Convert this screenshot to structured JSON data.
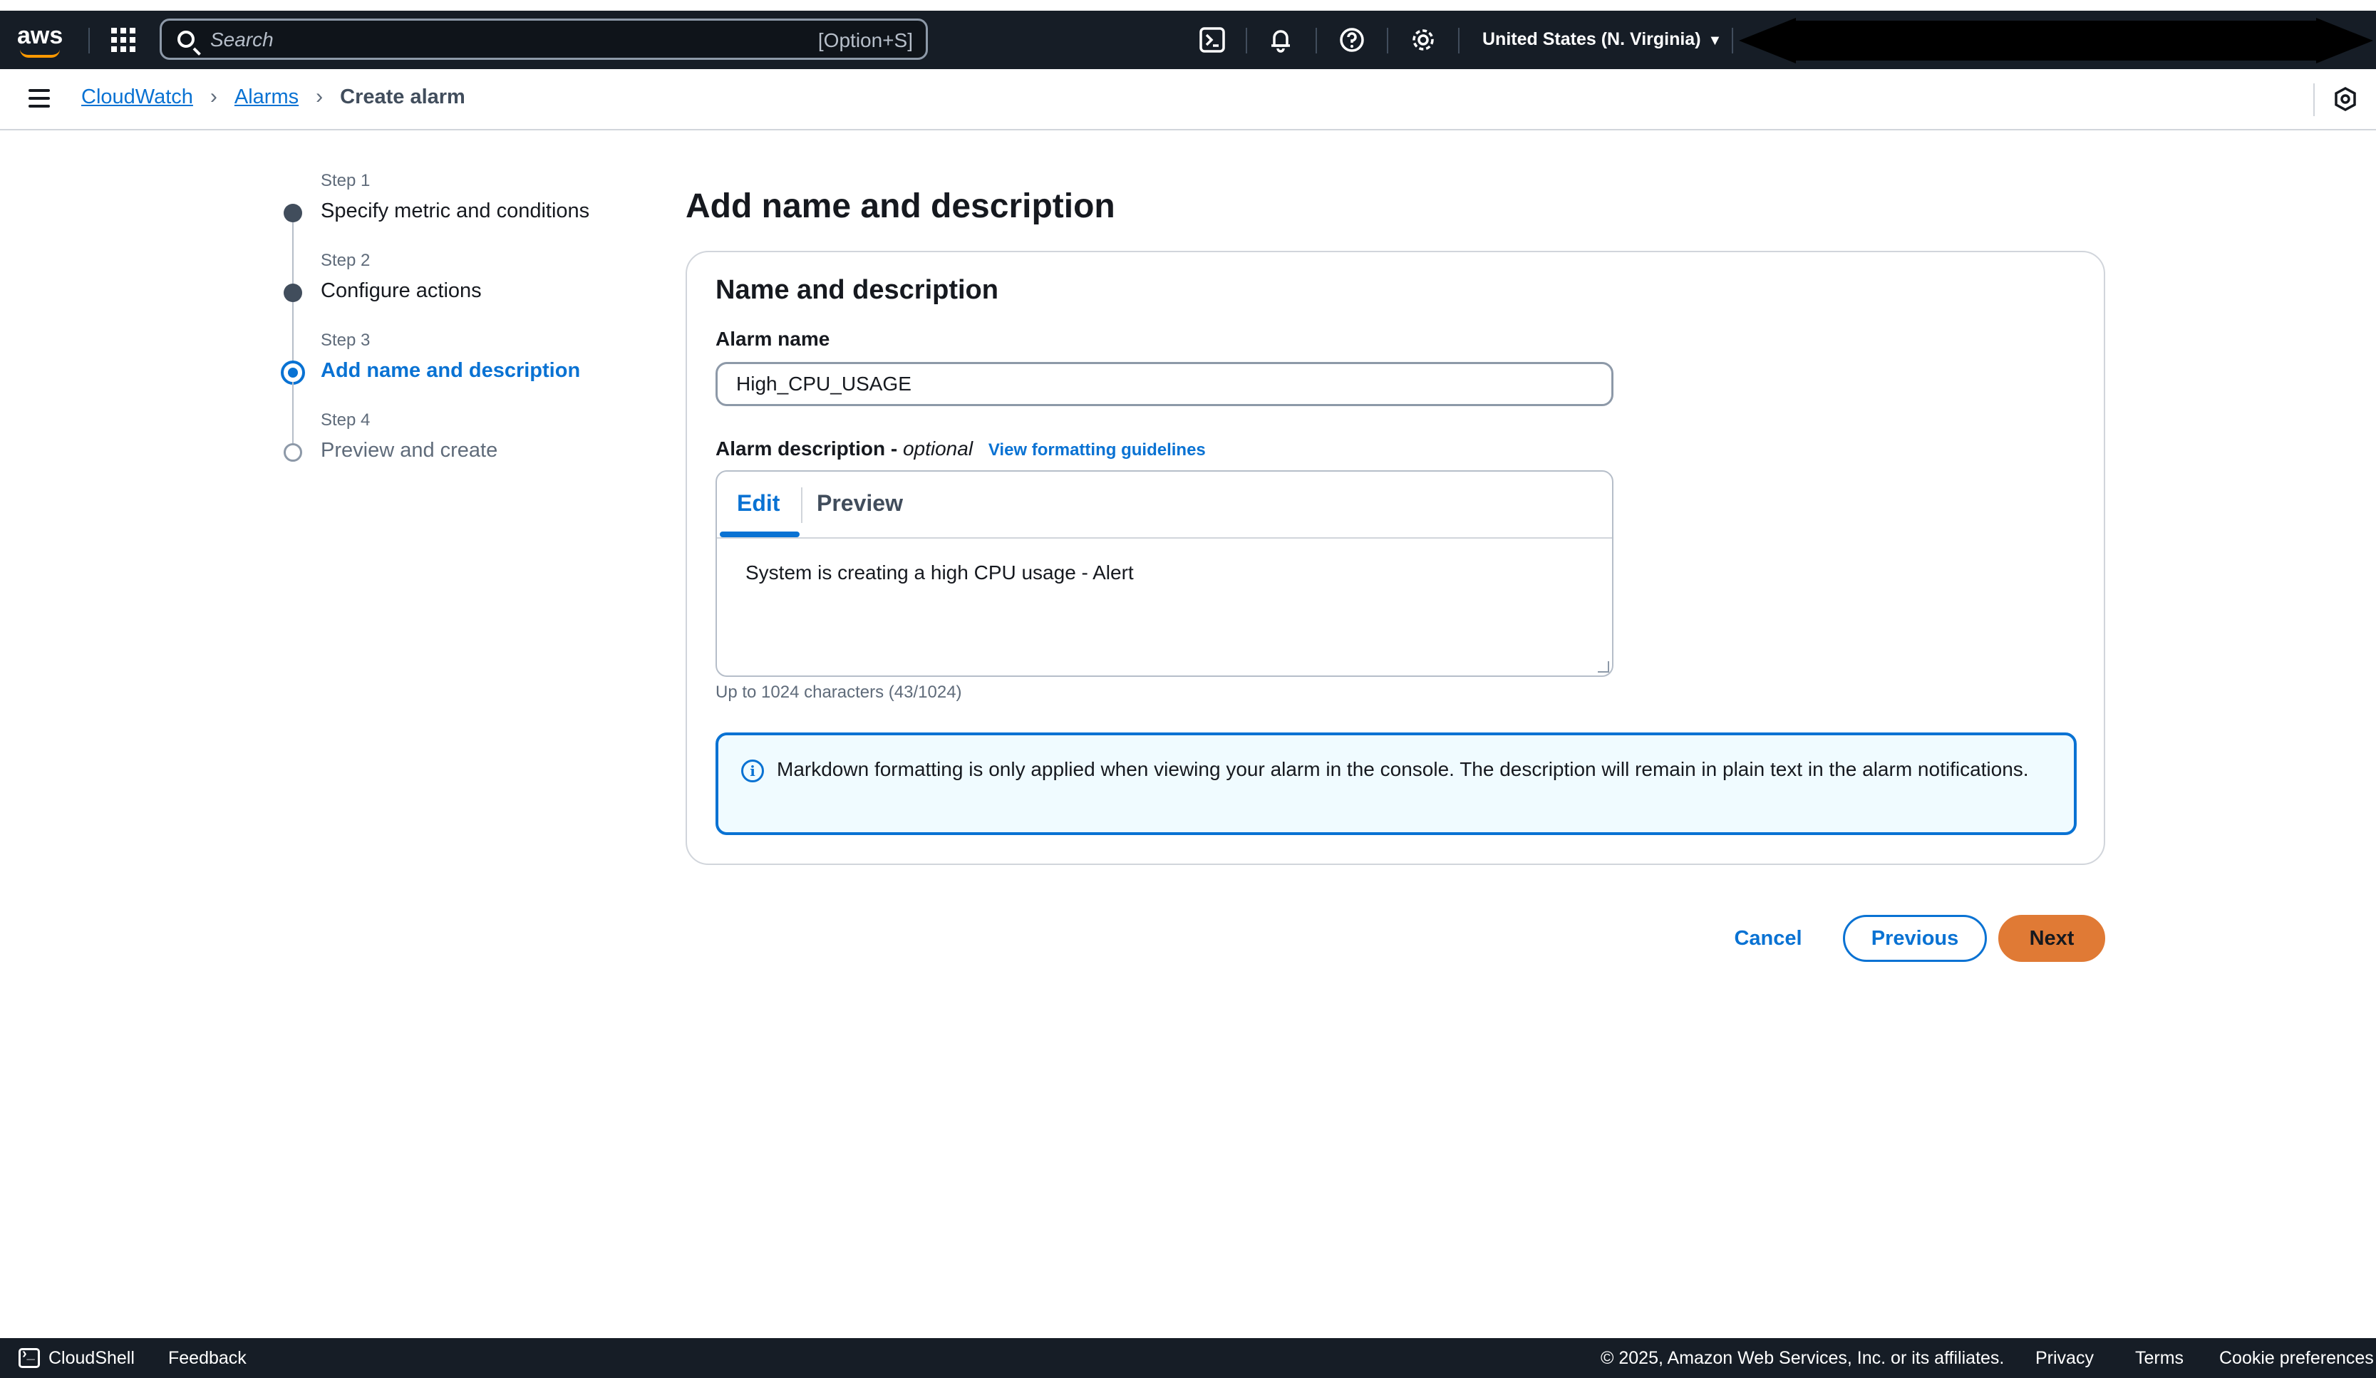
{
  "topbar": {
    "logo_text": "aws",
    "search_placeholder": "Search",
    "search_shortcut": "[Option+S]",
    "region": "United States (N. Virginia)",
    "region_caret": "▼"
  },
  "breadcrumb": {
    "items": [
      "CloudWatch",
      "Alarms"
    ],
    "current": "Create alarm",
    "separator": "›"
  },
  "steps": [
    {
      "num": "Step 1",
      "label": "Specify metric and conditions",
      "state": "completed"
    },
    {
      "num": "Step 2",
      "label": "Configure actions",
      "state": "completed"
    },
    {
      "num": "Step 3",
      "label": "Add name and description",
      "state": "active"
    },
    {
      "num": "Step 4",
      "label": "Preview and create",
      "state": "pending"
    }
  ],
  "main": {
    "page_title": "Add name and description",
    "container_title": "Name and description",
    "alarm_name_label": "Alarm name",
    "alarm_name_value": "High_CPU_USAGE",
    "alarm_desc_label": "Alarm description -",
    "alarm_desc_optional": "optional",
    "formatting_link": "View formatting guidelines",
    "tabs": [
      {
        "label": "Edit",
        "active": true
      },
      {
        "label": "Preview",
        "active": false
      }
    ],
    "description_value": "System is creating a high CPU usage - Alert",
    "char_count": "Up to 1024 characters (43/1024)",
    "info_icon": "i",
    "info_text": "Markdown formatting is only applied when viewing your alarm in the console. The description will remain in plain text in the alarm notifications."
  },
  "actions": {
    "cancel": "Cancel",
    "previous": "Previous",
    "next": "Next"
  },
  "footer": {
    "cloudshell": "CloudShell",
    "feedback": "Feedback",
    "copyright": "© 2025, Amazon Web Services, Inc. or its affiliates.",
    "privacy": "Privacy",
    "terms": "Terms",
    "cookies": "Cookie preferences"
  },
  "colors": {
    "nav_bg": "#161d26",
    "link_blue": "#0972d3",
    "primary_button": "#e07a35",
    "info_bg": "#f0fbff"
  }
}
